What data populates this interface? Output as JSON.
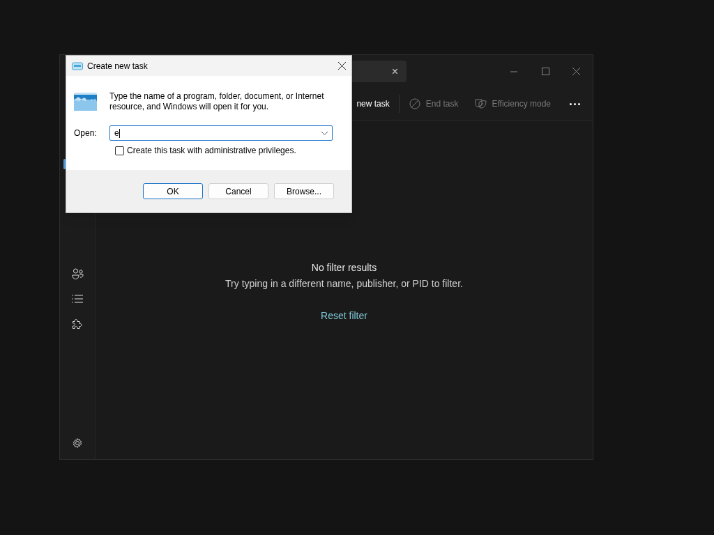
{
  "task_manager": {
    "search": {
      "clear": "×"
    },
    "toolbar": [
      {
        "label": "new task",
        "disabled": false
      },
      {
        "label": "End task",
        "disabled": true
      },
      {
        "label": "Efficiency mode",
        "disabled": true
      }
    ],
    "sidebar": [
      {
        "kind": "users"
      },
      {
        "kind": "details"
      },
      {
        "kind": "services"
      }
    ],
    "empty_state": {
      "title": "No filter results",
      "message": "Try typing in a different name, publisher, or PID to filter.",
      "link": "Reset filter"
    }
  },
  "dialog": {
    "title": "Create new task",
    "message": "Type the name of a program, folder, document, or Internet resource, and Windows will open it for you.",
    "open_label": "Open:",
    "open_value": "e",
    "admin_checkbox": {
      "label": "Create this task with administrative privileges.",
      "checked": false
    },
    "buttons": [
      {
        "label": "OK",
        "default": true
      },
      {
        "label": "Cancel",
        "default": false
      },
      {
        "label": "Browse...",
        "default": false
      }
    ]
  }
}
